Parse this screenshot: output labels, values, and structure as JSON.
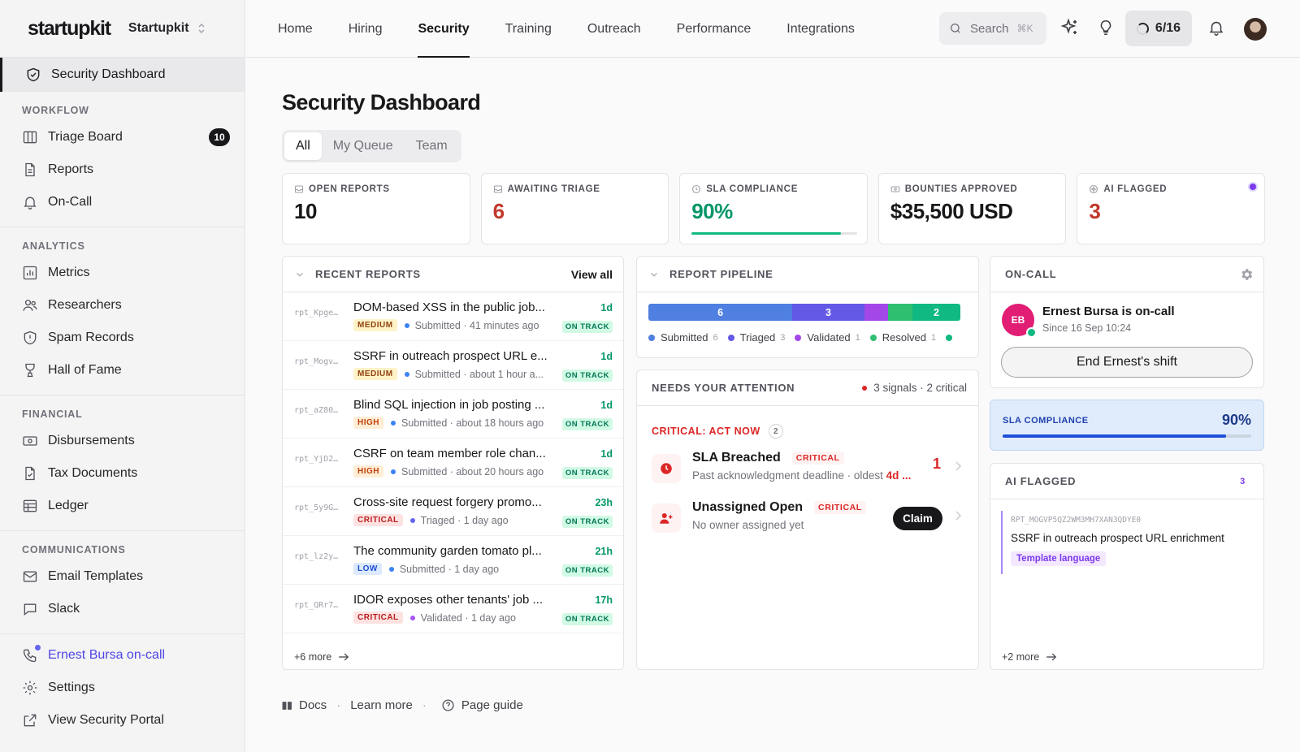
{
  "brand": {
    "logo": "startupkit",
    "org": "Startupkit"
  },
  "sidebar": {
    "active": "Security Dashboard",
    "sections": [
      {
        "title": "WORKFLOW",
        "items": [
          {
            "label": "Triage Board",
            "icon": "columns-icon",
            "badge": "10"
          },
          {
            "label": "Reports",
            "icon": "file-icon"
          },
          {
            "label": "On-Call",
            "icon": "bell-icon"
          }
        ]
      },
      {
        "title": "ANALYTICS",
        "items": [
          {
            "label": "Metrics",
            "icon": "bar-chart-icon"
          },
          {
            "label": "Researchers",
            "icon": "users-icon"
          },
          {
            "label": "Spam Records",
            "icon": "shield-alert-icon"
          },
          {
            "label": "Hall of Fame",
            "icon": "trophy-icon"
          }
        ]
      },
      {
        "title": "FINANCIAL",
        "items": [
          {
            "label": "Disbursements",
            "icon": "banknote-icon"
          },
          {
            "label": "Tax Documents",
            "icon": "file-check-icon"
          },
          {
            "label": "Ledger",
            "icon": "table-icon"
          }
        ]
      },
      {
        "title": "COMMUNICATIONS",
        "items": [
          {
            "label": "Email Templates",
            "icon": "mail-icon"
          },
          {
            "label": "Slack",
            "icon": "message-icon"
          }
        ]
      }
    ],
    "bottom": [
      {
        "label": "Ernest Bursa on-call",
        "icon": "phone-icon"
      },
      {
        "label": "Settings",
        "icon": "gear-icon"
      },
      {
        "label": "View Security Portal",
        "icon": "external-link-icon"
      }
    ]
  },
  "topnav": {
    "items": [
      "Home",
      "Hiring",
      "Security",
      "Training",
      "Outreach",
      "Performance",
      "Integrations"
    ],
    "active": "Security",
    "search_placeholder": "Search",
    "search_shortcut": "⌘K",
    "progress": "6/16"
  },
  "page": {
    "title": "Security Dashboard",
    "tabs": [
      "All",
      "My Queue",
      "Team"
    ],
    "active_tab": "All"
  },
  "kpis": [
    {
      "label": "OPEN REPORTS",
      "value": "10",
      "icon": "inbox-icon"
    },
    {
      "label": "AWAITING TRIAGE",
      "value": "6",
      "icon": "inbox-icon"
    },
    {
      "label": "SLA COMPLIANCE",
      "value": "90%",
      "icon": "clock-icon",
      "progress": 0.9
    },
    {
      "label": "BOUNTIES APPROVED",
      "value": "$35,500 USD",
      "icon": "banknote-icon"
    },
    {
      "label": "AI FLAGGED",
      "value": "3",
      "icon": "sparkle-icon"
    }
  ],
  "recent_reports": {
    "title": "RECENT REPORTS",
    "view_all": "View all",
    "rows": [
      {
        "id": "rpt_Kpge…",
        "title": "DOM-based XSS in the public job...",
        "severity": "MEDIUM",
        "status": "Submitted",
        "time": "41 minutes ago",
        "age": "1d",
        "track": "ON TRACK"
      },
      {
        "id": "rpt_Mogv…",
        "title": "SSRF in outreach prospect URL e...",
        "severity": "MEDIUM",
        "status": "Submitted",
        "time": "about 1 hour a...",
        "age": "1d",
        "track": "ON TRACK"
      },
      {
        "id": "rpt_aZ80…",
        "title": "Blind SQL injection in job posting ...",
        "severity": "HIGH",
        "status": "Submitted",
        "time": "about 18 hours ago",
        "age": "1d",
        "track": "ON TRACK"
      },
      {
        "id": "rpt_YjD2…",
        "title": "CSRF on team member role chan...",
        "severity": "HIGH",
        "status": "Submitted",
        "time": "about 20 hours ago",
        "age": "1d",
        "track": "ON TRACK"
      },
      {
        "id": "rpt_5y9G…",
        "title": "Cross-site request forgery promo...",
        "severity": "CRITICAL",
        "status": "Triaged",
        "time": "1 day ago",
        "age": "23h",
        "track": "ON TRACK"
      },
      {
        "id": "rpt_lz2y…",
        "title": "The community garden tomato pl...",
        "severity": "LOW",
        "status": "Submitted",
        "time": "1 day ago",
        "age": "21h",
        "track": "ON TRACK"
      },
      {
        "id": "rpt_QRr7…",
        "title": "IDOR exposes other tenants' job ...",
        "severity": "CRITICAL",
        "status": "Validated",
        "time": "1 day ago",
        "age": "17h",
        "track": "ON TRACK"
      }
    ],
    "more": "+6 more"
  },
  "pipeline": {
    "title": "REPORT PIPELINE",
    "segments": [
      {
        "label": "Submitted",
        "count": 6,
        "color": "#4f7fe0"
      },
      {
        "label": "Triaged",
        "count": 3,
        "color": "#6458e6"
      },
      {
        "label": "Validated",
        "count": 1,
        "color": "#a347e8"
      },
      {
        "label": "Resolved",
        "count": 1,
        "color": "#2fbf71"
      },
      {
        "label": "",
        "count": 2,
        "color": "#10b981"
      }
    ]
  },
  "attention": {
    "title": "NEEDS YOUR ATTENTION",
    "summary": "3 signals · 2 critical",
    "group_title": "CRITICAL: ACT NOW",
    "group_count": "2",
    "items": [
      {
        "title": "SLA Breached",
        "tag": "CRITICAL",
        "desc": "Past acknowledgment deadline · oldest ",
        "desc_strong": "4d ...",
        "count": "1"
      },
      {
        "title": "Unassigned Open",
        "tag": "CRITICAL",
        "desc": "No owner assigned yet",
        "action": "Claim"
      }
    ]
  },
  "oncall": {
    "title": "ON-CALL",
    "initials": "EB",
    "name": "Ernest Bursa is on-call",
    "since": "Since 16 Sep 10:24",
    "button": "End Ernest's shift"
  },
  "sla": {
    "label": "SLA COMPLIANCE",
    "value": "90%",
    "progress": 0.9
  },
  "ai_flagged": {
    "title": "AI FLAGGED",
    "count": "3",
    "item_id": "RPT_MOGVP5QZ2WM3MH7XAN3QDYE0",
    "item_title": "SSRF in outreach prospect URL enrichment",
    "item_tag": "Template language",
    "more": "+2 more"
  },
  "footer": {
    "docs": "Docs",
    "learn": "Learn more",
    "guide": "Page guide"
  },
  "colors": {
    "accent": "#18181b",
    "critical": "#dc2626",
    "success": "#10b981",
    "ai": "#7c3aed"
  }
}
